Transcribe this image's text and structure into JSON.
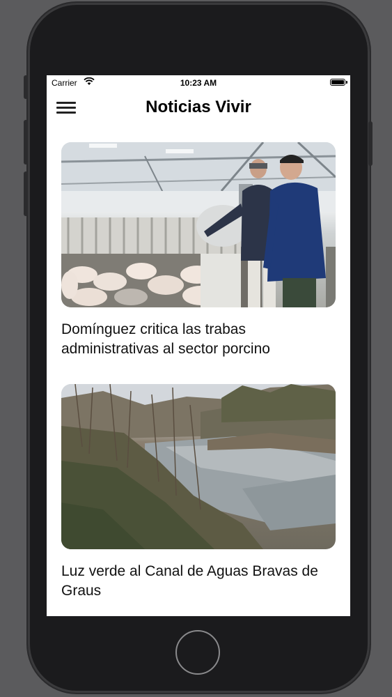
{
  "status_bar": {
    "carrier": "Carrier",
    "time": "10:23 AM"
  },
  "nav": {
    "title": "Noticias Vivir"
  },
  "articles": [
    {
      "headline": "Domínguez critica las trabas administrativas al sector porcino",
      "image": "two men in a pig farm barn"
    },
    {
      "headline": "Luz verde al Canal de Aguas Bravas de Graus",
      "image": "river with bare trees and bushes on bank"
    }
  ],
  "icons": [
    "wifi-icon",
    "battery-icon",
    "hamburger-menu-icon"
  ]
}
